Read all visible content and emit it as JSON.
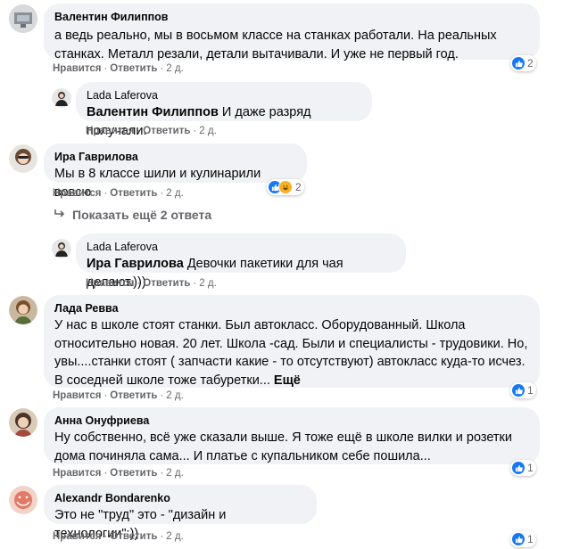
{
  "actions": {
    "like": "Нравится",
    "reply": "Ответить",
    "sep": "·"
  },
  "comments": [
    {
      "author": "Валентин Филиппов",
      "text": "а ведь реально, мы в восьмом классе на станках работали. На реальных станках. Металл резали, детали вытачивали. И уже не первый год.",
      "time": "2 д.",
      "reactions": {
        "types": [
          "like"
        ],
        "count": "2"
      }
    },
    {
      "author": "Lada Laferova",
      "mention": "Валентин Филиппов",
      "text": " И даже разряд получали.",
      "time": "2 д."
    },
    {
      "author": "Ира Гаврилова",
      "text": "Мы в 8 классе шили и кулинарили вовсю",
      "time": "2 д.",
      "reactions": {
        "types": [
          "like",
          "haha"
        ],
        "count": "2"
      }
    },
    {
      "author": "Lada Laferova",
      "mention": "Ира Гаврилова",
      "text": " Девочки пакетики для чая делают.)))",
      "time": "2 д."
    },
    {
      "author": "Лада Ревва",
      "text": "У нас в школе стоят станки. Был автокласс. Оборудованный. Школа относительно новая. 20 лет. Школа -сад. Были и специалисты - трудовики. Но, увы....станки стоят ( запчасти какие - то отсутствуют) автокласс куда-то исчез. В соседней школе тоже табуретки... ",
      "more": "Ещё",
      "time": "2 д.",
      "reactions": {
        "types": [
          "like"
        ],
        "count": "1"
      }
    },
    {
      "author": "Анна Онуфриева",
      "text": "Ну собственно, всё уже сказали выше. Я тоже ещё в школе вилки и розетки дома починяла сама... И платье с купальником себе пошила...",
      "time": "2 д.",
      "reactions": {
        "types": [
          "like"
        ],
        "count": "1"
      }
    },
    {
      "author": "Alexandr Bondarenko",
      "text": "Это не \"труд\" это - \"дизайн и технологии\":))",
      "time": "2 д.",
      "reactions": {
        "types": [
          "like"
        ],
        "count": "1"
      }
    }
  ],
  "show_more_replies": "Показать ещё 2 ответа",
  "colors": {
    "bubble": "#f0f2f5",
    "secondary_text": "#65676b",
    "like_blue": "#1877f2",
    "haha_yellow": "#f7b125"
  }
}
